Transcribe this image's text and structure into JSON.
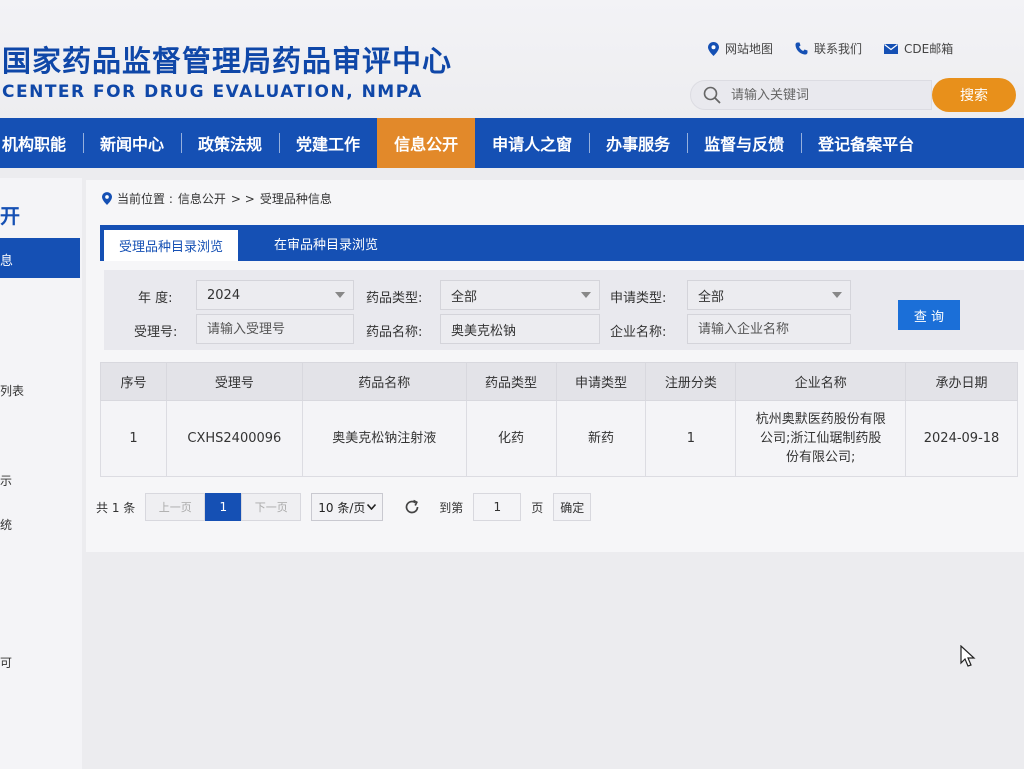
{
  "header": {
    "title_cn": "国家药品监督管理局药品审评中心",
    "title_en": "CENTER FOR DRUG EVALUATION, NMPA",
    "links": [
      {
        "label": "网站地图",
        "icon": "location-pin-icon"
      },
      {
        "label": "联系我们",
        "icon": "phone-icon"
      },
      {
        "label": "CDE邮箱",
        "icon": "mail-icon"
      }
    ],
    "search_placeholder": "请输入关键词",
    "search_button": "搜索"
  },
  "nav": {
    "items": [
      "机构职能",
      "新闻中心",
      "政策法规",
      "党建工作",
      "信息公开",
      "申请人之窗",
      "办事服务",
      "监督与反馈",
      "登记备案平台"
    ],
    "active_index": 4
  },
  "sidebar": {
    "title": "开",
    "active_item": "息",
    "items": [
      "列表",
      "示",
      "统",
      "可"
    ]
  },
  "breadcrumb": {
    "prefix": "当前位置 :",
    "path1": "信息公开",
    "sep": "> >",
    "path2": "受理品种信息"
  },
  "tabs": [
    "受理品种目录浏览",
    "在审品种目录浏览"
  ],
  "filters": {
    "year_label": "年   度:",
    "year_value": "2024",
    "drug_type_label": "药品类型:",
    "drug_type_value": "全部",
    "apply_type_label": "申请类型:",
    "apply_type_value": "全部",
    "accept_no_label": "受理号:",
    "accept_no_placeholder": "请输入受理号",
    "drug_name_label": "药品名称:",
    "drug_name_value": "奥美克松钠",
    "company_label": "企业名称:",
    "company_placeholder": "请输入企业名称",
    "query_button": "查 询"
  },
  "table": {
    "headers": [
      "序号",
      "受理号",
      "药品名称",
      "药品类型",
      "申请类型",
      "注册分类",
      "企业名称",
      "承办日期"
    ],
    "rows": [
      {
        "index": "1",
        "accept_no": "CXHS2400096",
        "drug_name": "奥美克松钠注射液",
        "drug_type": "化药",
        "apply_type": "新药",
        "reg_class": "1",
        "company_line1": "杭州奥默医药股份有限",
        "company_line2": "公司;浙江仙琚制药股",
        "company_line3": "份有限公司;",
        "date": "2024-09-18"
      }
    ]
  },
  "pager": {
    "total": "共 1 条",
    "prev": "上一页",
    "current": "1",
    "next": "下一页",
    "page_size": "10 条/页",
    "goto_label": "到第",
    "goto_value": "1",
    "page_suffix": "页",
    "confirm": "确定"
  },
  "colors": {
    "brand_blue": "#1550b4",
    "accent_orange": "#e2892a",
    "search_orange": "#e8901b",
    "query_blue": "#1b6fd8"
  }
}
